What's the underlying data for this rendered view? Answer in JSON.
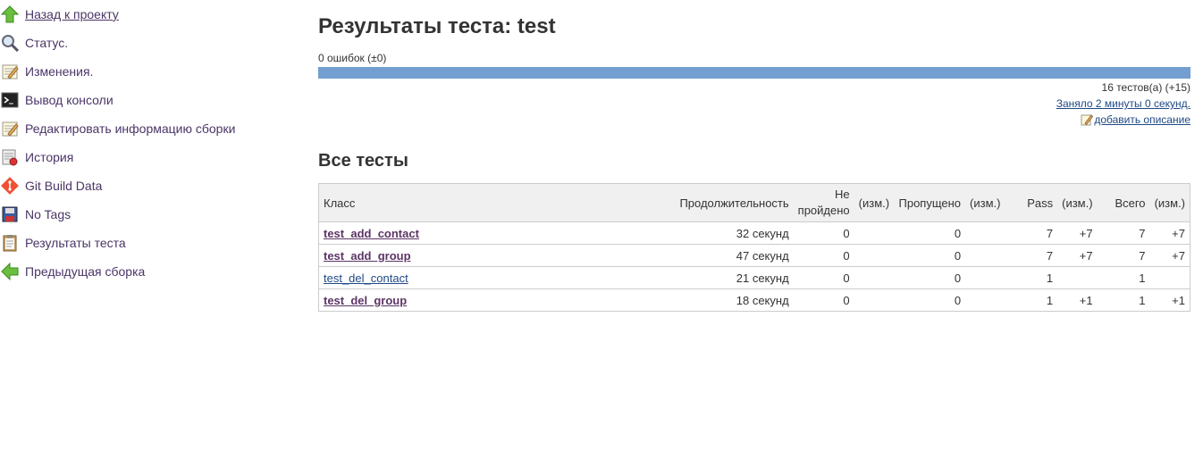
{
  "sidebar": {
    "items": [
      {
        "label": "Назад к проекту",
        "icon": "up-arrow-icon"
      },
      {
        "label": "Статус.",
        "icon": "search-icon"
      },
      {
        "label": "Изменения.",
        "icon": "notepad-icon"
      },
      {
        "label": "Вывод консоли",
        "icon": "terminal-icon"
      },
      {
        "label": "Редактировать информацию сборки",
        "icon": "notepad-edit-icon"
      },
      {
        "label": "История",
        "icon": "history-icon"
      },
      {
        "label": "Git Build Data",
        "icon": "git-icon"
      },
      {
        "label": "No Tags",
        "icon": "floppy-icon"
      },
      {
        "label": "Результаты теста",
        "icon": "clipboard-icon"
      },
      {
        "label": "Предыдущая сборка",
        "icon": "left-arrow-icon"
      }
    ]
  },
  "main": {
    "title": "Результаты теста: test",
    "fail_summary": "0 ошибок (±0)",
    "pass_ratio": 1.0,
    "tests_count": "16 тестов(а) (+15)",
    "duration_link": "Заняло 2 минуты 0 секунд.",
    "add_description": "добавить описание",
    "all_tests_title": "Все тесты"
  },
  "table": {
    "headers": {
      "class": "Класс",
      "duration": "Продолжительность",
      "failed": "Не пройдено",
      "diff": "(изм.)",
      "skipped": "Пропущено",
      "pass": "Pass",
      "total": "Всего"
    },
    "rows": [
      {
        "name": "test_add_contact",
        "duration": "32 секунд",
        "failed": "0",
        "failed_diff": "",
        "skipped": "0",
        "skipped_diff": "",
        "pass": "7",
        "pass_diff": "+7",
        "total": "7",
        "total_diff": "+7"
      },
      {
        "name": "test_add_group",
        "duration": "47 секунд",
        "failed": "0",
        "failed_diff": "",
        "skipped": "0",
        "skipped_diff": "",
        "pass": "7",
        "pass_diff": "+7",
        "total": "7",
        "total_diff": "+7"
      },
      {
        "name": "test_del_contact",
        "duration": "21 секунд",
        "failed": "0",
        "failed_diff": "",
        "skipped": "0",
        "skipped_diff": "",
        "pass": "1",
        "pass_diff": "",
        "total": "1",
        "total_diff": ""
      },
      {
        "name": "test_del_group",
        "duration": "18 секунд",
        "failed": "0",
        "failed_diff": "",
        "skipped": "0",
        "skipped_diff": "",
        "pass": "1",
        "pass_diff": "+1",
        "total": "1",
        "total_diff": "+1"
      }
    ]
  },
  "colors": {
    "pass_bar": "#729fcf",
    "link": "#204a87",
    "visited_link": "#5c3566"
  }
}
